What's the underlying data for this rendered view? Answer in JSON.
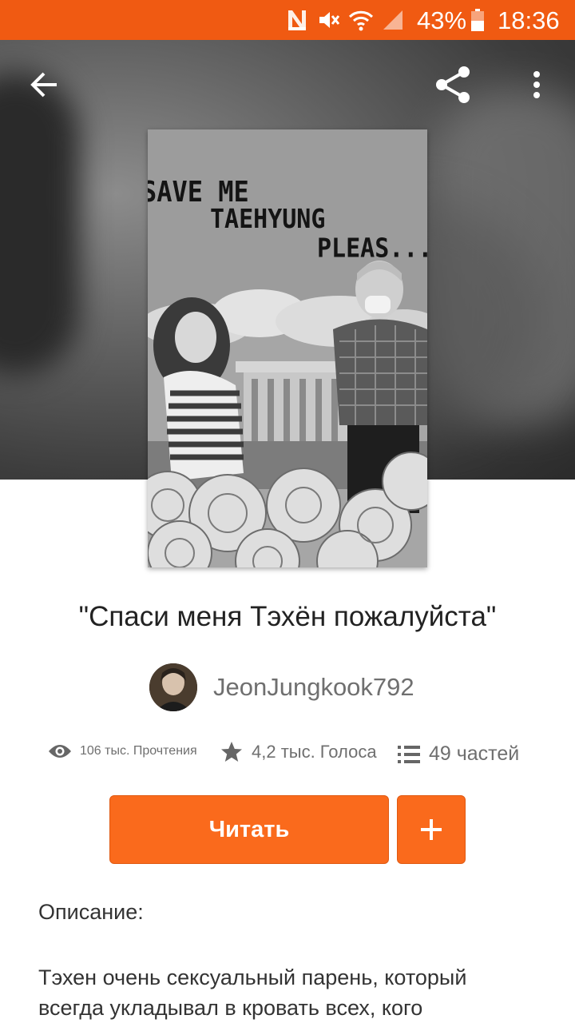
{
  "status_bar": {
    "battery_percent": "43%",
    "time": "18:36",
    "icons": [
      "n-notification-icon",
      "mute-icon",
      "wifi-icon",
      "signal-icon",
      "battery-icon"
    ]
  },
  "toolbar": {
    "icons": [
      "back-arrow-icon",
      "share-icon",
      "more-vertical-icon"
    ]
  },
  "cover": {
    "text_lines": [
      "SAVE ME",
      "TAEHYUNG",
      "PLEAS..."
    ]
  },
  "story": {
    "title": "\"Спаси меня Тэхён пожалуйста\"",
    "author": "JeonJungkook792",
    "reads": "106 тыс. Прочтения",
    "votes": "4,2 тыс. Голоса",
    "parts": "49 частей"
  },
  "actions": {
    "read_label": "Читать",
    "add_icon": "plus-icon"
  },
  "description": {
    "heading": "Описание:",
    "text": "Тэхен очень сексуальный парень, который всегда укладывал в кровать всех, кого"
  },
  "colors": {
    "accent": "#fa6a1c",
    "status_bar": "#f05a12"
  }
}
